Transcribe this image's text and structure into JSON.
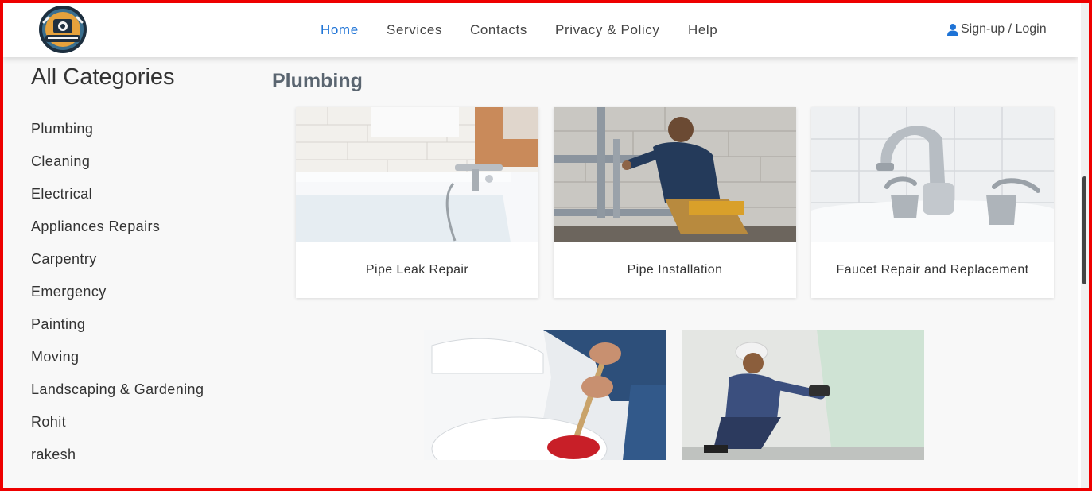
{
  "navbar": {
    "logo_text": "MAY I HELP YOU",
    "links": [
      {
        "label": "Home",
        "active": true
      },
      {
        "label": "Services",
        "active": false
      },
      {
        "label": "Contacts",
        "active": false
      },
      {
        "label": "Privacy & Policy",
        "active": false
      },
      {
        "label": "Help",
        "active": false
      }
    ],
    "login_label": "Sign-up / Login",
    "login_icon": "user-icon",
    "accent_color": "#1e73d6"
  },
  "sidebar": {
    "title": "All Categories",
    "items": [
      "Plumbing",
      "Cleaning",
      "Electrical",
      "Appliances Repairs",
      "Carpentry",
      "Emergency",
      "Painting",
      "Moving",
      "Landscaping & Gardening",
      "Rohit",
      "rakesh"
    ]
  },
  "main": {
    "section_title": "Plumbing",
    "services": [
      {
        "label": "Pipe Leak Repair",
        "image": "bathtub-faucet-image"
      },
      {
        "label": "Pipe Installation",
        "image": "plumber-installing-pipes-image"
      },
      {
        "label": "Faucet Repair and Replacement",
        "image": "chrome-faucet-image"
      },
      {
        "label": "",
        "image": "toilet-plunger-image"
      },
      {
        "label": "",
        "image": "worker-drilling-wall-image"
      }
    ]
  },
  "colors": {
    "frame_border": "#ee0000",
    "page_background": "#f8f8f8",
    "section_title": "#5a6570"
  }
}
